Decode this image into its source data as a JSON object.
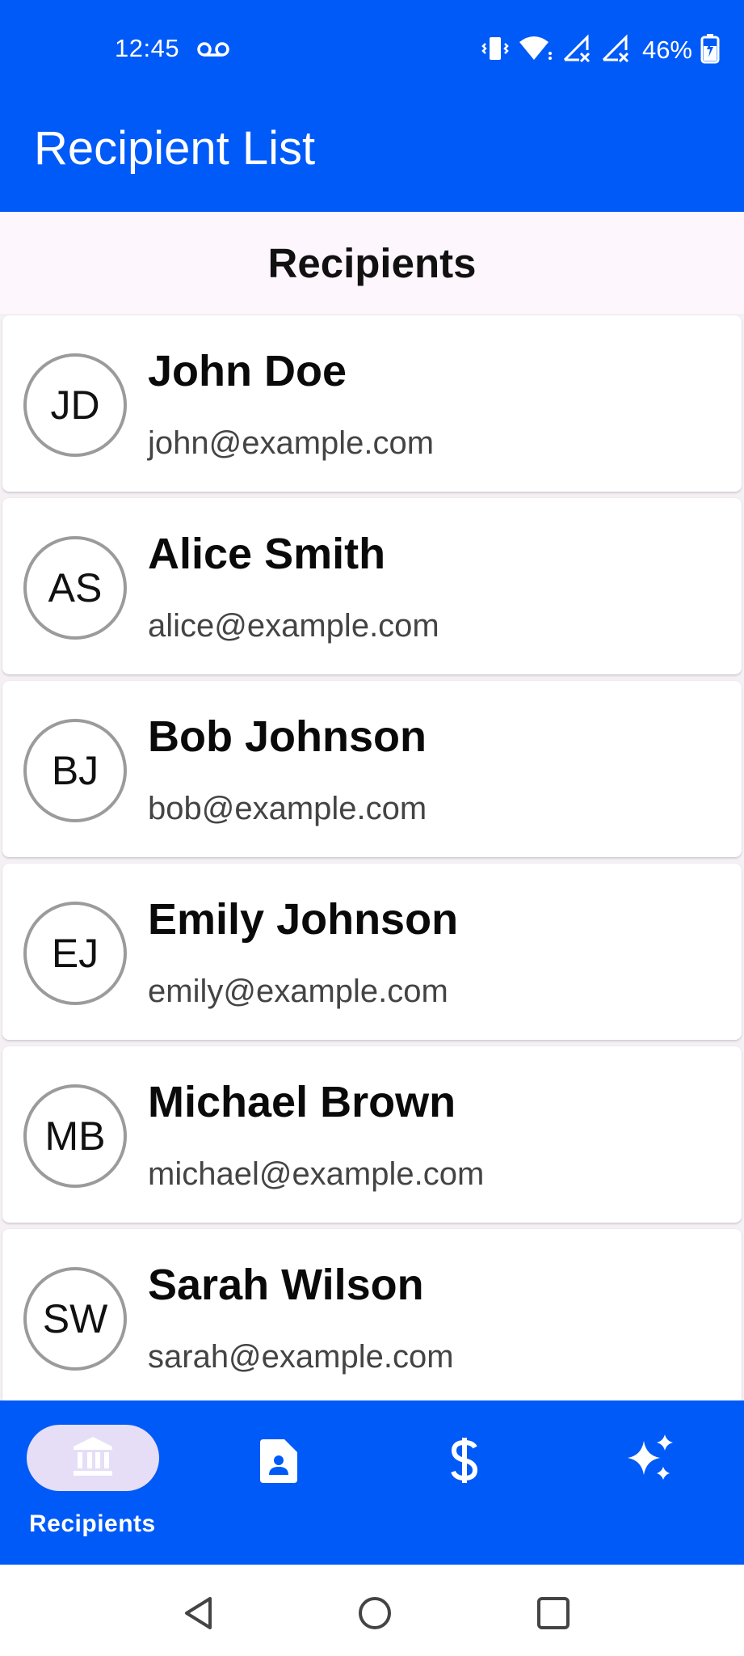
{
  "status_bar": {
    "time": "12:45",
    "battery": "46%",
    "icons": [
      "voicemail-icon",
      "vibrate-icon",
      "wifi-icon",
      "signal-icon",
      "signal-icon",
      "battery-charging-icon"
    ]
  },
  "app_bar": {
    "title": "Recipient List"
  },
  "section": {
    "title": "Recipients"
  },
  "recipients": [
    {
      "initials": "JD",
      "name": "John Doe",
      "email": "john@example.com"
    },
    {
      "initials": "AS",
      "name": "Alice Smith",
      "email": "alice@example.com"
    },
    {
      "initials": "BJ",
      "name": "Bob Johnson",
      "email": "bob@example.com"
    },
    {
      "initials": "EJ",
      "name": "Emily Johnson",
      "email": "emily@example.com"
    },
    {
      "initials": "MB",
      "name": "Michael Brown",
      "email": "michael@example.com"
    },
    {
      "initials": "SW",
      "name": "Sarah Wilson",
      "email": "sarah@example.com"
    }
  ],
  "bottom_nav": {
    "items": [
      {
        "label": "Recipients",
        "icon": "bank-icon",
        "selected": true
      },
      {
        "label": "",
        "icon": "contact-document-icon",
        "selected": false
      },
      {
        "label": "",
        "icon": "dollar-icon",
        "selected": false
      },
      {
        "label": "",
        "icon": "sparkles-icon",
        "selected": false
      }
    ]
  },
  "colors": {
    "primary": "#005AF8",
    "header_background": "#FDF7FD",
    "selected_pill": "#E6DEF7",
    "avatar_border": "#9B9B9B"
  }
}
